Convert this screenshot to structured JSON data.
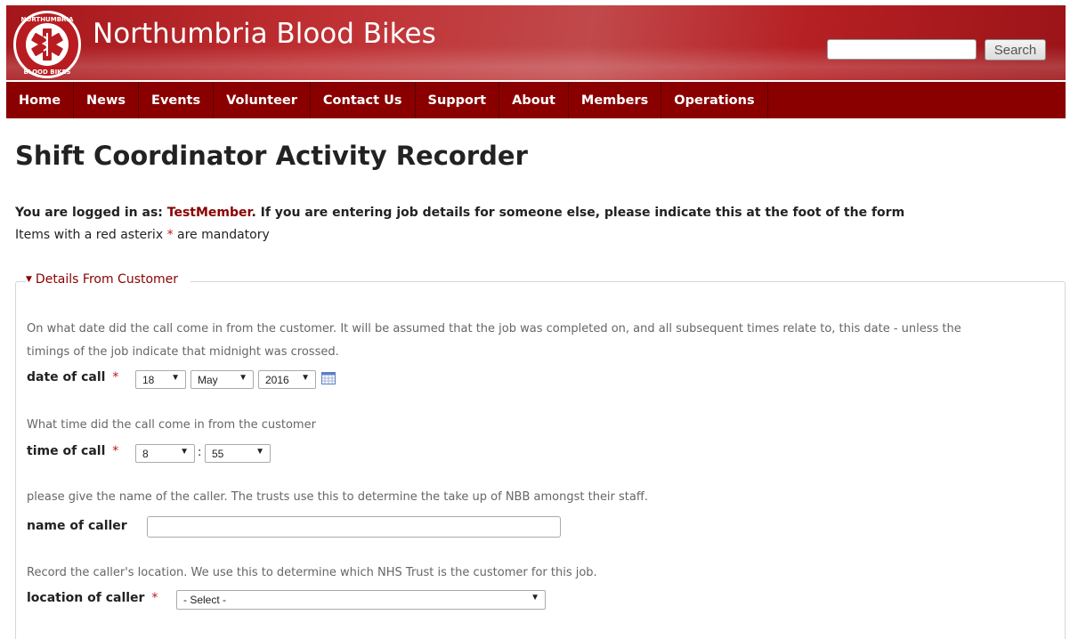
{
  "header": {
    "site_title": "Northumbria Blood Bikes",
    "logo_text_top": "NORTHUMBRIA",
    "logo_text_bottom": "BLOOD BIKES",
    "search_placeholder": "",
    "search_button": "Search"
  },
  "nav": {
    "items": [
      "Home",
      "News",
      "Events",
      "Volunteer",
      "Contact Us",
      "Support",
      "About",
      "Members",
      "Operations"
    ]
  },
  "page": {
    "title": "Shift Coordinator Activity Recorder",
    "login_prefix": "You are logged in as: ",
    "username": "TestMember",
    "login_suffix": ". If you are entering job details for someone else, please indicate this at the foot of the form",
    "mandatory_prefix": "Items with a red asterix ",
    "mandatory_star": "*",
    "mandatory_suffix": " are mandatory"
  },
  "fieldset": {
    "legend": "Details From Customer",
    "date_help_line1": "On what date did the call come in from the customer. It will be assumed that the job was completed on, and all subsequent times relate to, this date - unless the",
    "date_help_line2": "timings of the job indicate that midnight was crossed.",
    "date_label": "date of call",
    "date_day": "18",
    "date_month": "May",
    "date_year": "2016",
    "time_help": "What time did the call come in from the customer",
    "time_label": "time of call",
    "time_hour": "8",
    "time_separator": ":",
    "time_minute": "55",
    "caller_help": "please give the name of the caller. The trusts use this to determine the take up of NBB amongst their staff.",
    "caller_label": "name of caller",
    "caller_value": "",
    "location_help": "Record the caller's location. We use this to determine which NHS Trust is the customer for this job.",
    "location_label": "location of caller",
    "location_value": "- Select -",
    "required_mark": "*"
  },
  "colors": {
    "header_red": "#b52024",
    "nav_red": "#8a0000",
    "asterisk_red": "#c0141a"
  }
}
